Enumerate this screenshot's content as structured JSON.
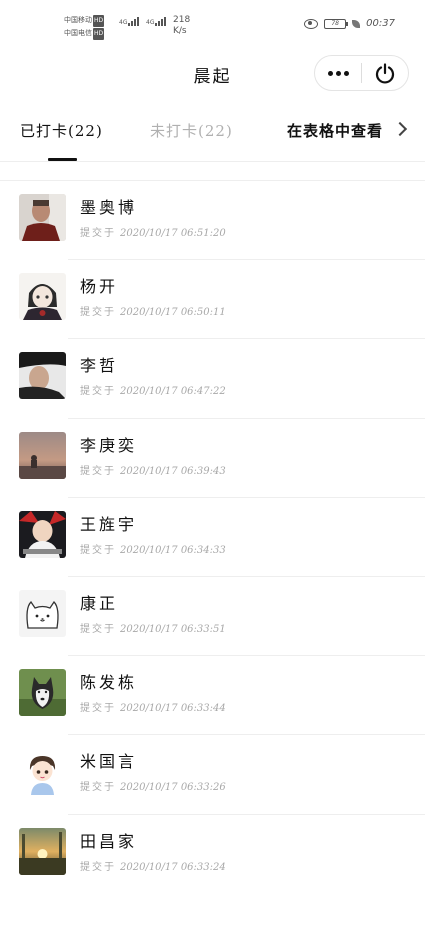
{
  "status_bar": {
    "carrier1": "中国移动",
    "carrier2": "中国电信",
    "hd_badge": "HD",
    "net_type": "4G",
    "speed_value": "218",
    "speed_unit": "K/s",
    "battery": "78",
    "time": "00:37"
  },
  "nav": {
    "title": "晨起"
  },
  "tabs": {
    "checked_in": "已打卡(22)",
    "not_checked_in": "未打卡(22)",
    "view_in_table": "在表格中查看"
  },
  "submit_label": "提交于",
  "entries": [
    {
      "name": "墨奥博",
      "time": "2020/10/17 06:51:20",
      "avatar": "man-portrait-red"
    },
    {
      "name": "杨开",
      "time": "2020/10/17 06:50:11",
      "avatar": "anime-character"
    },
    {
      "name": "李哲",
      "time": "2020/10/17 06:47:22",
      "avatar": "man-cap-dark"
    },
    {
      "name": "李庚奕",
      "time": "2020/10/17 06:39:43",
      "avatar": "sunset-silhouette"
    },
    {
      "name": "王旌宇",
      "time": "2020/10/17 06:34:33",
      "avatar": "bald-hero"
    },
    {
      "name": "康正",
      "time": "2020/10/17 06:33:51",
      "avatar": "white-cat"
    },
    {
      "name": "陈发栋",
      "time": "2020/10/17 06:33:44",
      "avatar": "husky-dog"
    },
    {
      "name": "米国言",
      "time": "2020/10/17 06:33:26",
      "avatar": "cartoon-boy"
    },
    {
      "name": "田昌家",
      "time": "2020/10/17 06:33:24",
      "avatar": "sunrise-field"
    }
  ]
}
